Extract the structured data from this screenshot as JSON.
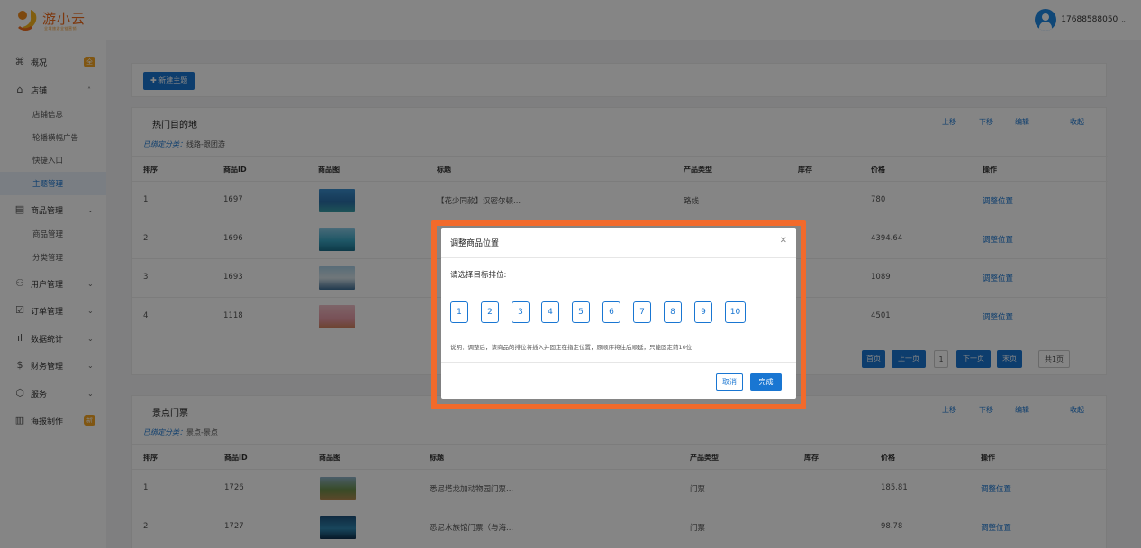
{
  "brand": {
    "name": "游小云",
    "tagline": "全域旅游全链营销"
  },
  "user": {
    "phone": "17688588050"
  },
  "sidebar": {
    "overview": {
      "label": "概况",
      "badge": "全"
    },
    "shop": {
      "label": "店铺"
    },
    "shop_items": [
      "店铺信息",
      "轮播横幅广告",
      "快捷入口",
      "主题管理"
    ],
    "goods": {
      "label": "商品管理"
    },
    "goods_items": [
      "商品管理",
      "分类管理"
    ],
    "users": {
      "label": "用户管理"
    },
    "orders": {
      "label": "订单管理"
    },
    "stats": {
      "label": "数据统计"
    },
    "finance": {
      "label": "财务管理"
    },
    "service": {
      "label": "服务"
    },
    "poster": {
      "label": "海报制作",
      "badge": "新"
    }
  },
  "toolbar": {
    "new_theme": "新建主题"
  },
  "columns": [
    "排序",
    "商品ID",
    "商品图",
    "标题",
    "产品类型",
    "库存",
    "价格",
    "操作"
  ],
  "section_actions": {
    "up": "上移",
    "down": "下移",
    "edit": "编辑",
    "collapse": "收起"
  },
  "bound_label": "已绑定分类：",
  "row_action": "调整位置",
  "sections": [
    {
      "title": "热门目的地",
      "bound_value": "线路-跟团游",
      "rows": [
        {
          "order": "1",
          "id": "1697",
          "title": "【花少同款】汉密尔顿...",
          "type": "路线",
          "stock": "",
          "price": "780"
        },
        {
          "order": "2",
          "id": "1696",
          "title": "",
          "type": "",
          "stock": "",
          "price": "4394.64"
        },
        {
          "order": "3",
          "id": "1693",
          "title": "",
          "type": "",
          "stock": "",
          "price": "1089"
        },
        {
          "order": "4",
          "id": "1118",
          "title": "",
          "type": "",
          "stock": "",
          "price": "4501"
        }
      ]
    },
    {
      "title": "景点门票",
      "bound_value": "景点-景点",
      "rows": [
        {
          "order": "1",
          "id": "1726",
          "title": "悉尼塔龙加动物园门票...",
          "type": "门票",
          "stock": "",
          "price": "185.81"
        },
        {
          "order": "2",
          "id": "1727",
          "title": "悉尼水族馆门票（与海...",
          "type": "门票",
          "stock": "",
          "price": "98.78"
        }
      ]
    }
  ],
  "pagination": {
    "first": "首页",
    "prev": "上一页",
    "current": "1",
    "next": "下一页",
    "last": "末页",
    "total": "共1页"
  },
  "modal": {
    "title": "调整商品位置",
    "prompt": "请选择目标排位:",
    "positions": [
      "1",
      "2",
      "3",
      "4",
      "5",
      "6",
      "7",
      "8",
      "9",
      "10"
    ],
    "note": "说明：调整后，该商品的排位将插入并固定在指定位置，原顺序将往后顺延，只能固定前10位",
    "cancel": "取消",
    "confirm": "完成"
  },
  "colors": {
    "primary": "#1976d2",
    "brand": "#f06b1c",
    "badge": "#f5a623",
    "highlight": "#f26a2b"
  }
}
